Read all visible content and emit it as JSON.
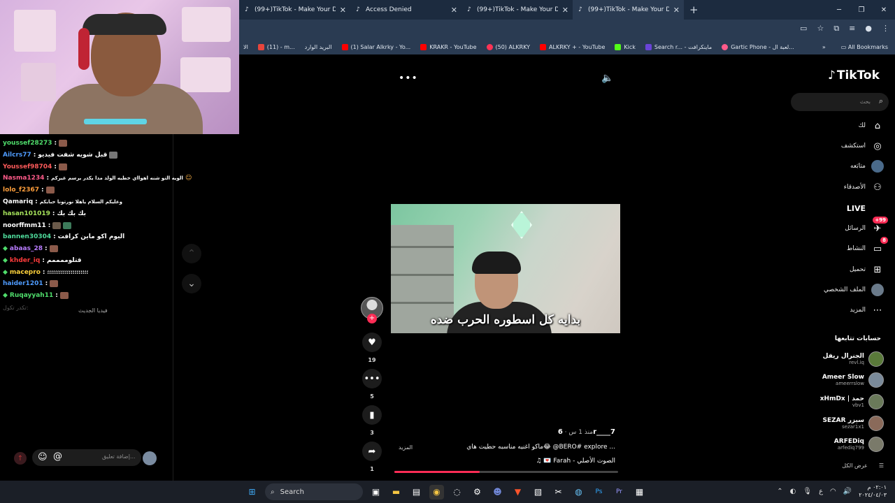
{
  "browser": {
    "tabs": [
      {
        "title": "(99+)TikTok - Make Your Day",
        "icon": "tiktok-icon",
        "active": false
      },
      {
        "title": "Access Denied",
        "icon": "tiktok-icon",
        "active": false
      },
      {
        "title": "(99+)TikTok - Make Your Day",
        "icon": "tiktok-icon",
        "active": false
      },
      {
        "title": "(99+)TikTok - Make Your Day",
        "icon": "tiktok-icon",
        "active": true
      }
    ],
    "bookmarks": [
      {
        "label": "الا",
        "color": "#555"
      },
      {
        "label": "(11) - m...",
        "color": "#e8453c"
      },
      {
        "label": "البريد الوارد",
        "color": "#d44"
      },
      {
        "label": "(1) Salar Alkrky - Yo...",
        "color": "#ff0000"
      },
      {
        "label": "KRAKR - YouTube",
        "color": "#ff0000"
      },
      {
        "label": "(50) ALKRKY",
        "color": "#ff3355"
      },
      {
        "label": "ALKRKY + - YouTube",
        "color": "#ff0000"
      },
      {
        "label": "Kick",
        "color": "#53fc18"
      },
      {
        "label": "Search r... - ماينكرافت",
        "color": "#6a44d8"
      },
      {
        "label": "Gartic Phone - لعبة ال...",
        "color": "#ff5a8a"
      }
    ],
    "all_bookmarks": "All Bookmarks"
  },
  "chat": {
    "messages": [
      {
        "user": "youssef28273",
        "color": "#4fdc6b",
        "text": "",
        "badge": false
      },
      {
        "user": "Ailcrs77",
        "color": "#4f9cff",
        "text": "قبل شويه شفت فيديو",
        "badge": false
      },
      {
        "user": "Youssef98704",
        "color": "#ff5b5b",
        "text": "",
        "badge": false
      },
      {
        "user": "Nasma1234",
        "color": "#ff5b8a",
        "text": "الويه التو شنه اهوااي خطيه الولد مدا يكدر يرسم غيركم",
        "badge": false
      },
      {
        "user": "lolo_f2367",
        "color": "#ff9f3c",
        "text": "",
        "badge": false
      },
      {
        "user": "Qamariq",
        "color": "#ffffff",
        "text": "وعليكم السلام ياهلا نورتونا حبايكم",
        "badge": false
      },
      {
        "user": "hasan101019",
        "color": "#a6e35b",
        "text": "بك بك بك",
        "badge": false
      },
      {
        "user": "noorffmm11",
        "color": "#ffffff",
        "text": "",
        "badge": false
      },
      {
        "user": "bannen30304",
        "color": "#4fdc9c",
        "text": "اليوم اكو ماين كرافت",
        "badge": false
      },
      {
        "user": "abaas_28",
        "color": "#b97cff",
        "text": "",
        "badge": true
      },
      {
        "user": "khder_iq",
        "color": "#ff3b3b",
        "text": "قتلوممممم",
        "badge": true
      },
      {
        "user": "macepro",
        "color": "#ffd23c",
        "text": "؛؛؛؛؛؛؛؛؛؛؛؛؛؛؛؛؛؛؛؛؛",
        "badge": true
      },
      {
        "user": "haider1201",
        "color": "#4f9cff",
        "text": "",
        "badge": false
      },
      {
        "user": "Ruqayyah11",
        "color": "#4fdc6b",
        "text": "",
        "badge": true
      }
    ],
    "typing_hint": "تكدر تكول:",
    "new_label": "فيديا الجديث",
    "comment_placeholder": "إضافة تعليق..."
  },
  "video": {
    "caption": "بدايه كل اسطوره الحرب ضده",
    "author": "6r____7",
    "time_ago": "منذ 1 س",
    "description": "ماكو اغنيه مناسبه حطيت هاي😂 @BERO# explore ...",
    "more": "المزيد",
    "sound": "♫ 💌 Farah - الصوت الأصلي",
    "progress": 0.38,
    "actions": {
      "likes": "19",
      "comments": "5",
      "saves": "3",
      "shares": "1"
    }
  },
  "sidebar": {
    "logo": "TikTok",
    "search_placeholder": "بحث",
    "menu": [
      {
        "label": "لك",
        "icon": "home-icon"
      },
      {
        "label": "استكشف",
        "icon": "compass-icon"
      },
      {
        "label": "متابَعه",
        "icon": "following-icon"
      },
      {
        "label": "الأصدقاء",
        "icon": "friends-icon"
      },
      {
        "label": "LIVE",
        "icon": "live-icon"
      },
      {
        "label": "الرسائل",
        "icon": "messages-icon",
        "badge": "+99"
      },
      {
        "label": "النشاط",
        "icon": "activity-icon",
        "badge": "8"
      },
      {
        "label": "تحميل",
        "icon": "upload-icon"
      },
      {
        "label": "الملف الشخصي",
        "icon": "profile-icon"
      },
      {
        "label": "المزيد",
        "icon": "more-icon"
      }
    ],
    "following_title": "حسابات تتابعها",
    "accounts": [
      {
        "name": "الجنرال ريفل",
        "handle": "revl.iq"
      },
      {
        "name": "Ameer Slow",
        "handle": "ameerrslow"
      },
      {
        "name": "xHmDx | حمد",
        "handle": "vbv1"
      },
      {
        "name": "SEZAR سيزر",
        "handle": "sezar1x1"
      },
      {
        "name": "ARFEDiq",
        "handle": "arfediq799"
      }
    ],
    "see_all": "عرض الكل"
  },
  "taskbar": {
    "search": "Search",
    "time": "٠٢:٠١ م",
    "date": "٢٠٢٤/٠٤/٠٣",
    "lang": "ع"
  }
}
